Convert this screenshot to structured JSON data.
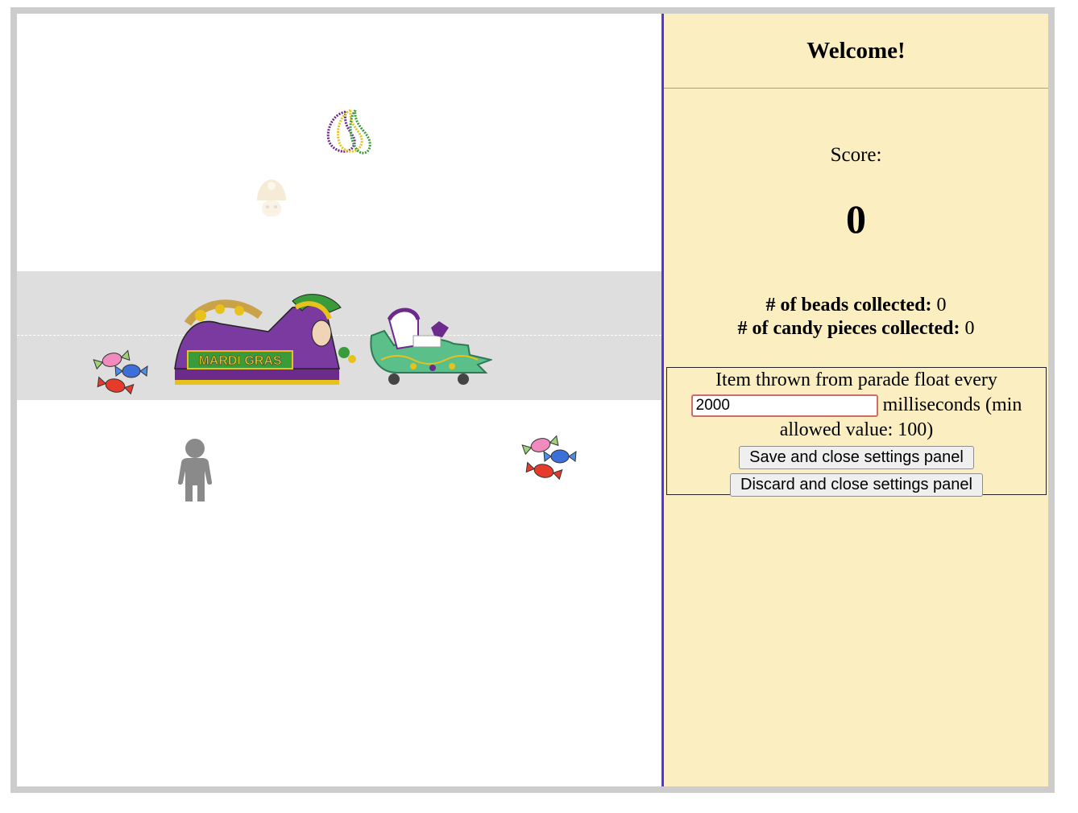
{
  "panel": {
    "welcome": "Welcome!",
    "score_label": "Score:",
    "score_value": "0",
    "beads_label": "# of beads collected:",
    "beads_value": "0",
    "candy_label": "# of candy pieces collected:",
    "candy_value": "0"
  },
  "settings": {
    "text_before": "Item thrown from parade float every",
    "interval_value": "2000",
    "text_after": "milliseconds (min allowed value: 100)",
    "save_label": "Save and close settings panel",
    "discard_label": "Discard and close settings panel"
  },
  "float": {
    "banner_text": "MARDI GRAS"
  },
  "colors": {
    "road": "#dedede",
    "divider": "#5533dd",
    "panel_bg": "#fbeec1",
    "mardi_purple": "#6b2a8c",
    "mardi_green": "#3a9b3a",
    "mardi_gold": "#e8c21a"
  },
  "icons": [
    "bead-necklace-icon",
    "mushroom-icon",
    "candy-icon",
    "player-icon",
    "float-icon",
    "alligator-float-icon"
  ]
}
